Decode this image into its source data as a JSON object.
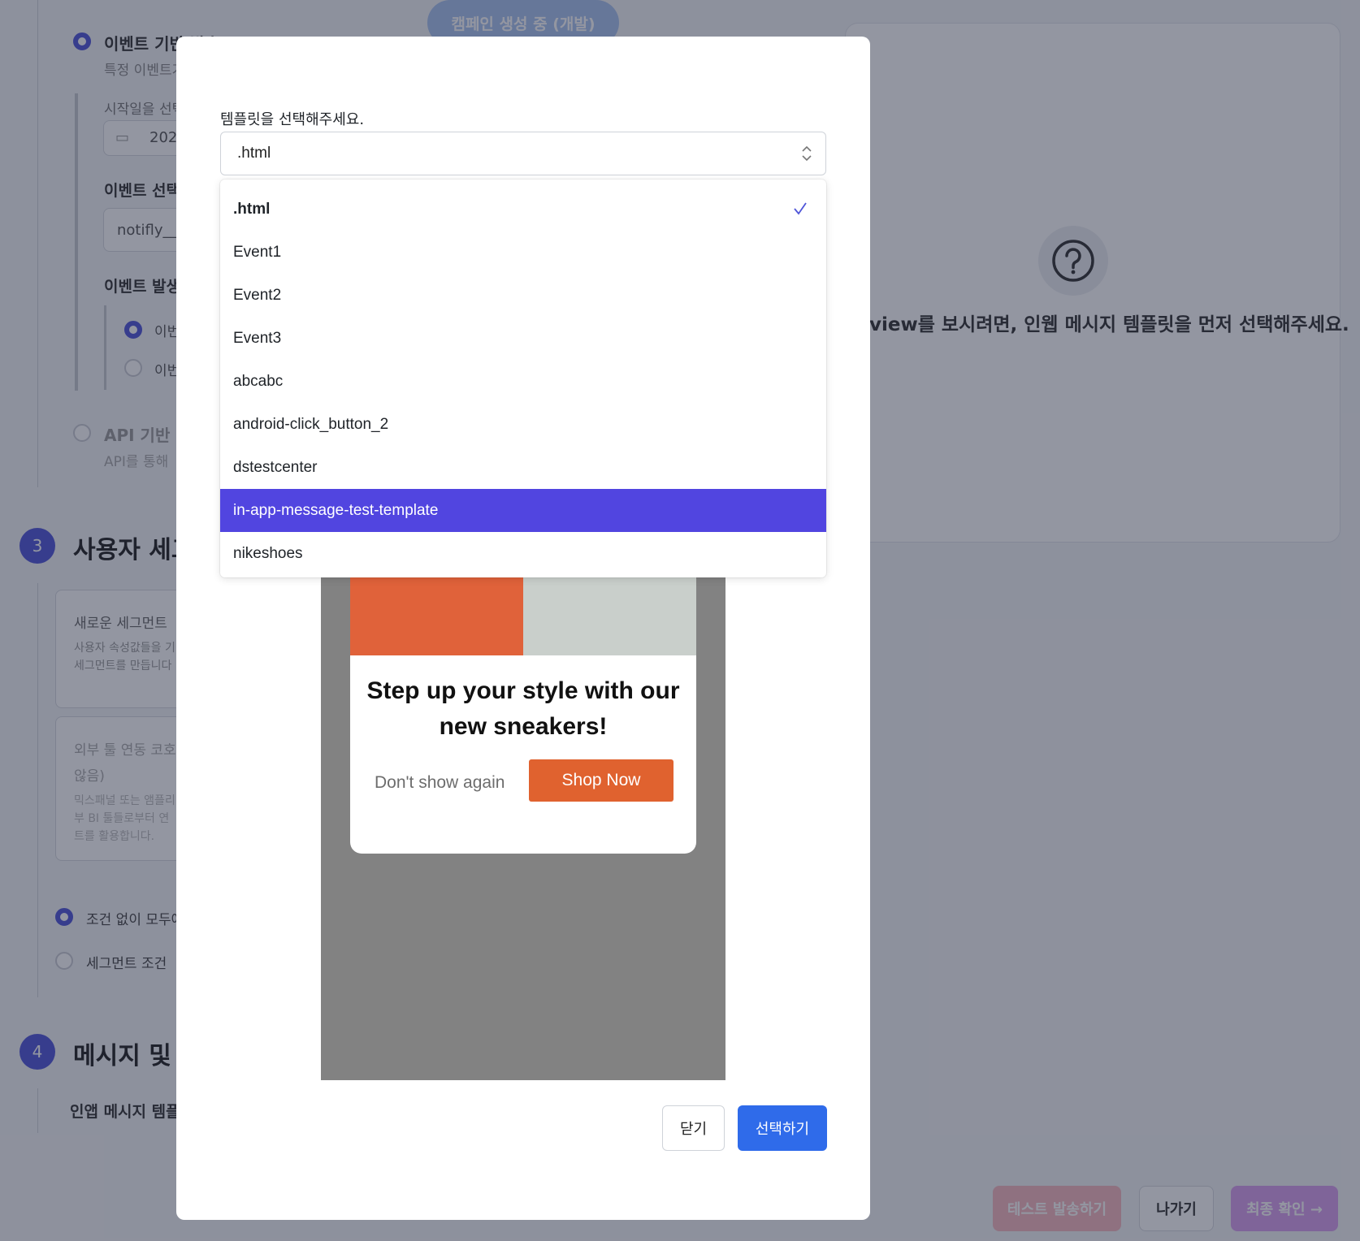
{
  "background": {
    "header_pill": "캠페인 생성 중 (개발)",
    "event_based": {
      "title": "이벤트 기반 발송",
      "desc": "특정 이벤트가"
    },
    "start_date_label": "시작일을 선택",
    "start_date_value": "202",
    "event_select_label": "이벤트 선택",
    "event_select_value": "notifly__",
    "event_occurrence_label": "이벤트 발생",
    "event_occurrence_opt1": "이번",
    "event_occurrence_opt2": "이번",
    "api_based": {
      "title": "API 기반 발",
      "desc": "API를 통해"
    },
    "step3": {
      "number": "3",
      "title": "사용자 세그"
    },
    "new_segment": {
      "title": "새로운 세그먼트",
      "desc1": "사용자 속성값들을 기",
      "desc2": "세그먼트를 만듭니다"
    },
    "external_segment": {
      "title1": "외부 툴 연동 코호",
      "title2": "않음)",
      "desc1": "믹스패널 또는 앰플리",
      "desc2": "부 BI 툴들로부터 연",
      "desc3": "트를 활용합니다."
    },
    "all_users_label": "조건 없이 모두에",
    "segment_condition_label": "세그먼트 조건 ",
    "step4": {
      "number": "4",
      "title": "메시지 및 의"
    },
    "inapp_template_label": "인앱 메시지 템플",
    "preview_hint": "view를 보시려면, 인웹 메시지 템플릿을 먼저 선택해주세요.",
    "test_send_button": "테스트 발송하기",
    "exit_button": "나가기",
    "final_confirm_button": "최종 확인 →"
  },
  "modal": {
    "label": "템플릿을 선택해주세요.",
    "selected_value": ".html",
    "options": [
      ".html",
      "Event1",
      "Event2",
      "Event3",
      "abcabc",
      "android-click_button_2",
      "dstestcenter",
      "in-app-message-test-template",
      "nikeshoes"
    ],
    "selected_index": 0,
    "highlighted_index": 7,
    "preview": {
      "title_line1": "Step up your style with our",
      "title_line2": "new sneakers!",
      "dismiss_label": "Don't show again",
      "cta_label": "Shop Now"
    },
    "close_button": "닫기",
    "select_button": "선택하기"
  },
  "colors": {
    "accent": "#5145e0",
    "primary_button": "#2f6bea",
    "cta_orange": "#e0622f"
  }
}
